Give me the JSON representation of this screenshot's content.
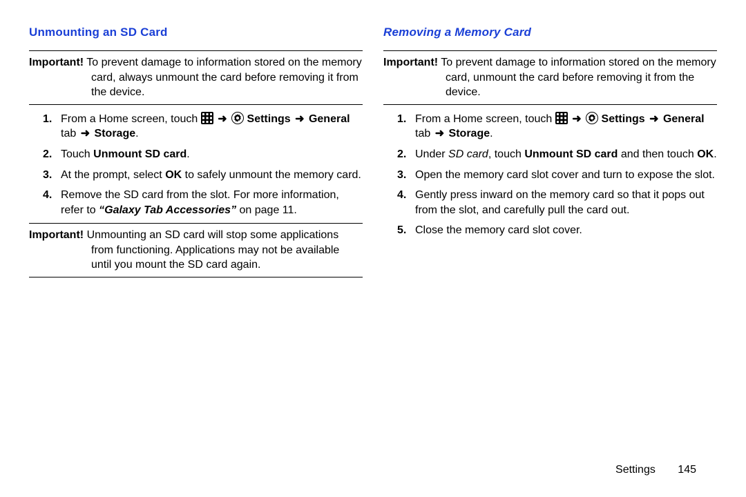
{
  "left": {
    "heading": "Unmounting an SD Card",
    "important1_label": "Important!",
    "important1_text": "To prevent damage to information stored on the memory card, always unmount the card before removing it from the device.",
    "step1_pre": "From a Home screen, touch ",
    "nav_settings": "Settings",
    "nav_general": "General",
    "nav_tab": " tab ",
    "nav_storage": "Storage",
    "step2_a": "Touch ",
    "step2_b": "Unmount SD card",
    "step3_a": "At the prompt, select ",
    "step3_b": "OK",
    "step3_c": " to safely unmount the memory card.",
    "step4_a": "Remove the SD card from the slot. For more information, refer to ",
    "step4_b": "“Galaxy Tab Accessories”",
    "step4_c": " on page 11.",
    "important2_label": "Important!",
    "important2_text": "Unmounting an SD card will stop some applications from functioning. Applications may not be available until you mount the SD card again."
  },
  "right": {
    "heading": "Removing a Memory Card",
    "important1_label": "Important!",
    "important1_text": "To prevent damage to information stored on the memory card, unmount the card before removing it from the device.",
    "step1_pre": "From a Home screen, touch ",
    "nav_settings": "Settings",
    "nav_general": "General",
    "nav_tab": " tab ",
    "nav_storage": "Storage",
    "step2_a": "Under ",
    "step2_b": "SD card",
    "step2_c": ", touch ",
    "step2_d": "Unmount SD card",
    "step2_e": " and then touch ",
    "step2_f": "OK",
    "step3": "Open the memory card slot cover and turn to expose the slot.",
    "step4": "Gently press inward on the memory card so that it pops out from the slot, and carefully pull the card out.",
    "step5": "Close the memory card slot cover."
  },
  "footer": {
    "section": "Settings",
    "page": "145"
  },
  "glyphs": {
    "arrow": "➜"
  }
}
